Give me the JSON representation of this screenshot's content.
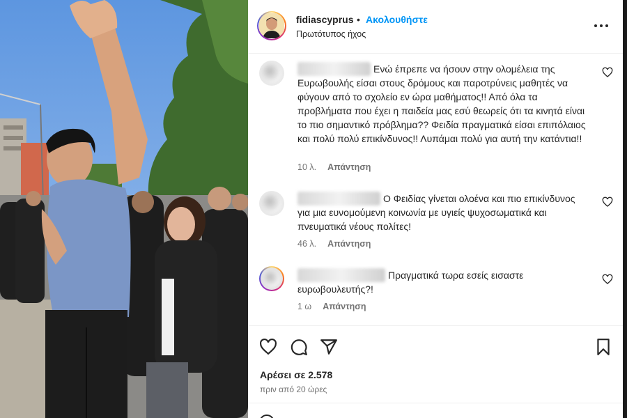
{
  "post": {
    "username": "fidiascyprus",
    "dot": "•",
    "follow_label": "Ακολουθήστε",
    "audio_label": "Πρωτότυπος ήχος"
  },
  "comments": [
    {
      "text": "Ενώ έπρεπε να ήσουν στην ολομέλεια της Ευρωβουλής είσαι στους δρόμους και παροτρύνεις μαθητές να φύγουν από το σχολείο εν ώρα μαθήματος!! Από όλα τα προβλήματα που έχει η παιδεία μας εσύ θεωρείς ότι τα κινητά είναι το πιο σημαντικό πρόβλημα?? Φειδία πραγματικά είσαι επιπόλαιος και πολύ πολύ επικίνδυνος!! Λυπάμαι πολύ για αυτή την κατάντια!!",
      "age": "10 λ.",
      "reply_label": "Απάντηση"
    },
    {
      "text": "Ο Φειδίας γίνεται ολοένα και πιο επικίνδυνος για μια ευνομούμενη κοινωνία με υγιείς ψυχοσωματικά και πνευματικά νέους πολίτες!",
      "age": "46 λ.",
      "reply_label": "Απάντηση"
    },
    {
      "text": "Πραγματικά τωρα εσείς εισαστε ευρωβουλευτής?!",
      "age": "1 ω",
      "reply_label": "Απάντηση"
    }
  ],
  "likes_label": "Αρέσει σε 2.578",
  "time_label": "πριν από 20 ώρες",
  "icons": {
    "more": "more-options-icon",
    "like": "heart-icon",
    "comment": "comment-icon",
    "share": "share-icon",
    "save": "bookmark-icon"
  },
  "colors": {
    "accent": "#0095f6",
    "text": "#262626",
    "secondary": "#737373"
  }
}
